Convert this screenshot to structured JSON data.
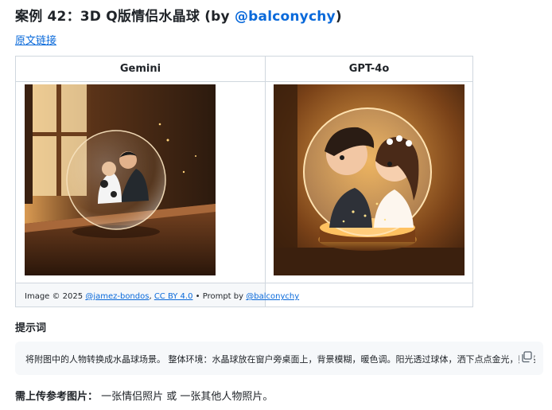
{
  "title": {
    "prefix": "案例 42：3D Q版情侣水晶球 (by ",
    "author": "@balconychy",
    "suffix": ")"
  },
  "source_link": "原文链接",
  "comparison": {
    "columns": [
      "Gemini",
      "GPT-4o"
    ],
    "caption": {
      "prefix": "Image © 2025 ",
      "author_link": "@jamez-bondos",
      "sep": ", ",
      "license_link": "CC BY 4.0",
      "prompt_by": " • Prompt by ",
      "prompt_link": "@balconychy"
    }
  },
  "prompt_section": {
    "heading": "提示词",
    "prompt_text": "将附图中的人物转换成水晶球场景。 整体环境：水晶球放在窗户旁桌面上，背景模糊，暖色调。阳光透过球体，洒下点点金光，照亮"
  },
  "requirement": {
    "label": "需上传参考图片：",
    "text": " 一张情侣照片 或 一张其他人物照片。"
  }
}
